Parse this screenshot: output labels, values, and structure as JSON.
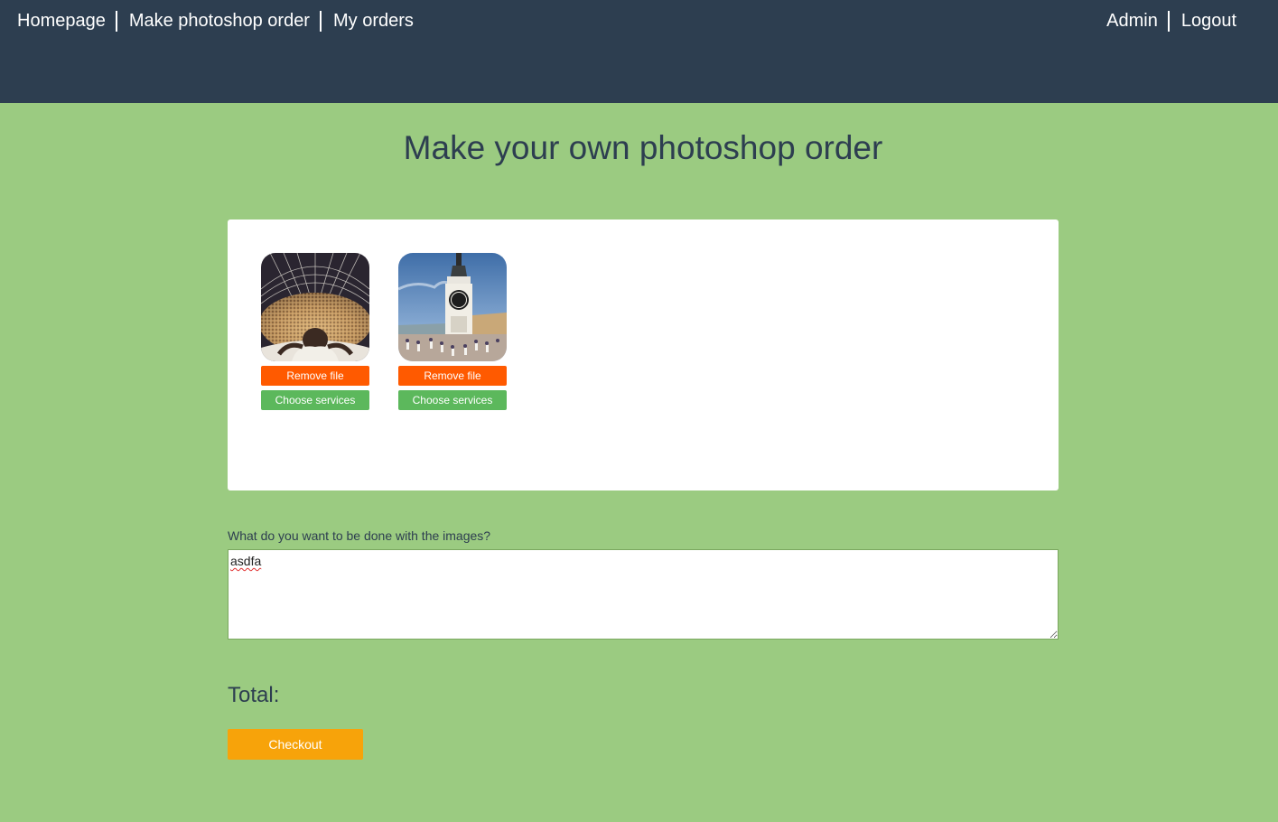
{
  "nav": {
    "left": [
      "Homepage",
      "Make photoshop order",
      "My orders"
    ],
    "right": [
      "Admin",
      "Logout"
    ]
  },
  "page_title": "Make your own photoshop order",
  "files": [
    {
      "image": "concert-crowd-photo",
      "remove_label": "Remove file",
      "services_label": "Choose services"
    },
    {
      "image": "clock-tower-photo",
      "remove_label": "Remove file",
      "services_label": "Choose services"
    }
  ],
  "instructions": {
    "label": "What do you want to be done with the images?",
    "value": "asdfa"
  },
  "total_label": "Total:",
  "checkout_label": "Checkout",
  "colors": {
    "header": "#2d3e50",
    "background": "#9bcb81",
    "remove": "#ff5a00",
    "services": "#5cb85c",
    "checkout": "#f7a30a"
  }
}
